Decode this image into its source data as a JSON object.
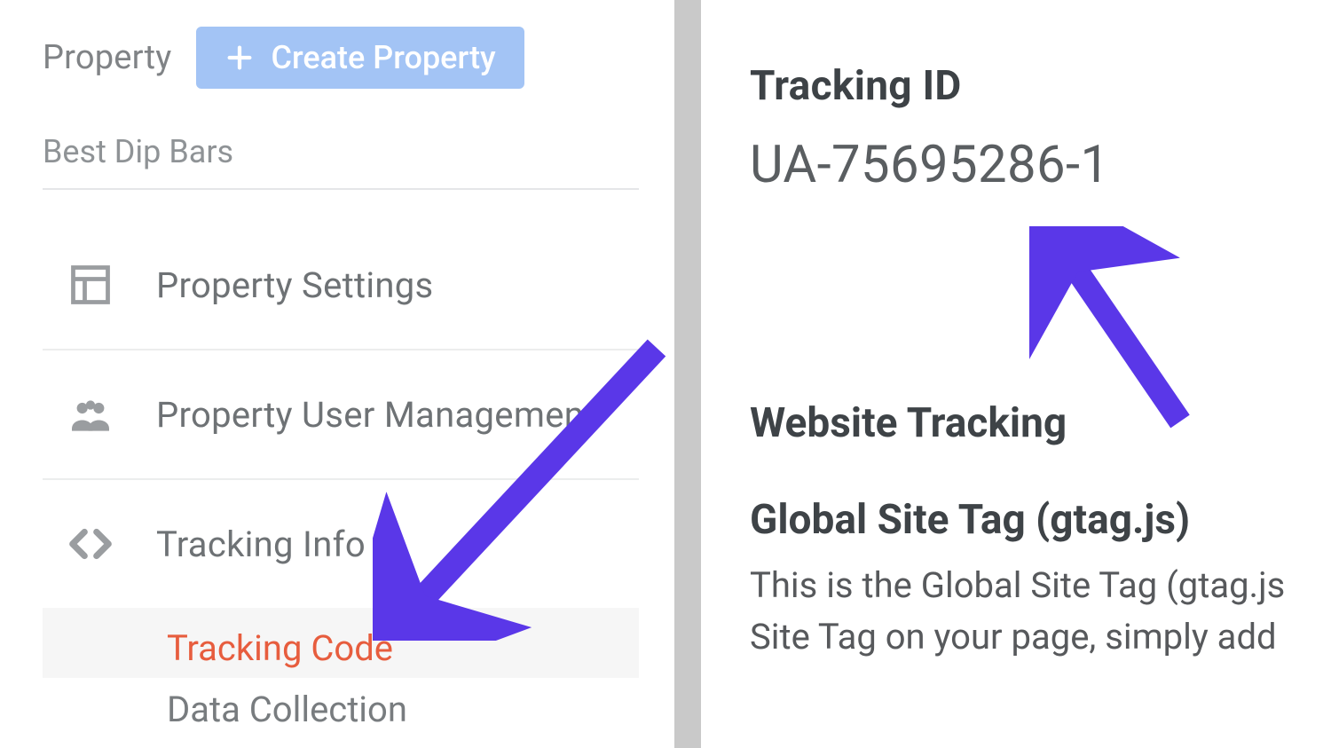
{
  "sidebar": {
    "column_label": "Property",
    "create_button_label": "Create Property",
    "property_name": "Best Dip Bars",
    "items": [
      {
        "label": "Property Settings"
      },
      {
        "label": "Property User Management"
      },
      {
        "label": "Tracking Info"
      }
    ],
    "tracking_info_children": [
      {
        "label": "Tracking Code",
        "active": true
      },
      {
        "label": "Data Collection",
        "active": false
      }
    ]
  },
  "main": {
    "tracking_id_heading": "Tracking ID",
    "tracking_id_value": "UA-75695286-1",
    "website_tracking_heading": "Website Tracking",
    "gtag_heading": "Global Site Tag (gtag.js)",
    "gtag_desc_line1": "This is the Global Site Tag (gtag.js",
    "gtag_desc_line2": "Site Tag on your page, simply add"
  },
  "annotations": {
    "arrow_color": "#5a37e8"
  }
}
